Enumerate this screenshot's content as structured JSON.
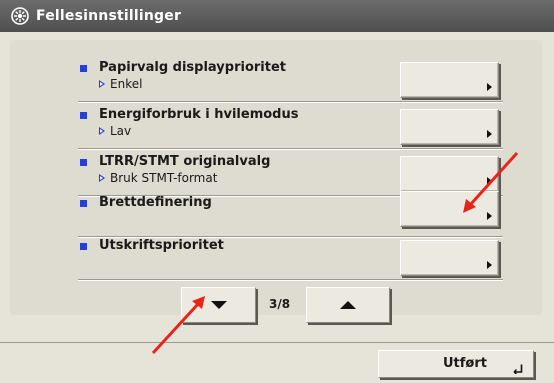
{
  "window": {
    "title": "Fellesinnstillinger",
    "title_icon": "settings-icon"
  },
  "settings": [
    {
      "label": "Papirvalg displayprioritet",
      "value": "Enkel"
    },
    {
      "label": "Energiforbruk i hvilemodus",
      "value": "Lav"
    },
    {
      "label": "LTRR/STMT originalvalg",
      "value": "Bruk STMT-format"
    },
    {
      "label": "Brettdefinering",
      "value": ""
    },
    {
      "label": "Utskriftsprioritet",
      "value": ""
    }
  ],
  "pager": {
    "indicator": "3/8",
    "prev_icon": "arrow-down-icon",
    "next_icon": "arrow-up-icon"
  },
  "footer": {
    "done_label": "Utført",
    "done_icon": "enter-icon"
  },
  "colors": {
    "title_bar": "#5c5c5c",
    "bullet": "#2a3fd1",
    "annotation_arrow": "#e8251b"
  }
}
